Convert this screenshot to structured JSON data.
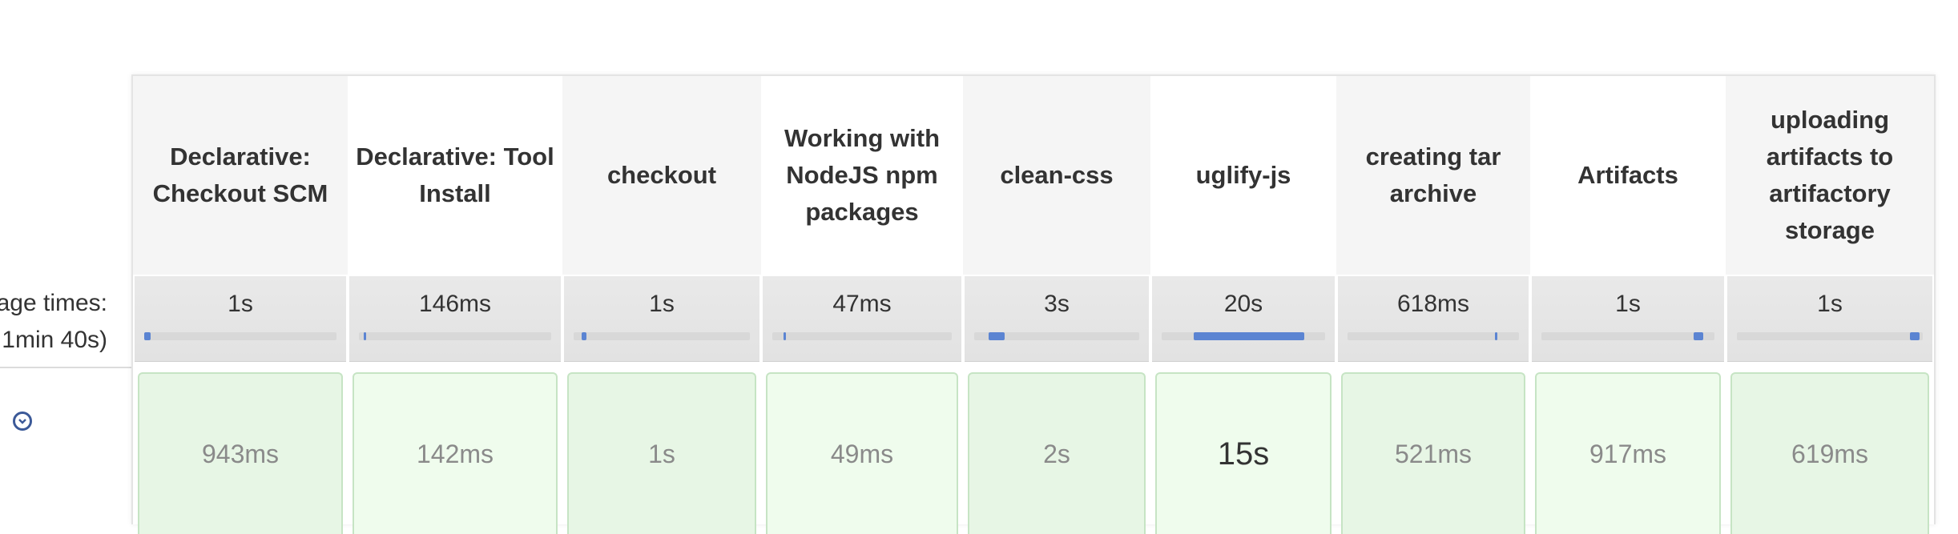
{
  "sidebar": {
    "avg_label_line1": "age times:",
    "avg_label_line2": "1min 40s)",
    "expand_icon": "expand-circle-icon"
  },
  "stages": [
    {
      "name": "Declarative: Checkout SCM",
      "avg": "1s",
      "progress": 0.0,
      "time": "943ms"
    },
    {
      "name": "Declarative: Tool Install",
      "avg": "146ms",
      "progress": 0.0,
      "time": "142ms"
    },
    {
      "name": "checkout",
      "avg": "1s",
      "progress": 0.0,
      "time": "1s"
    },
    {
      "name": "Working with NodeJS npm packages",
      "avg": "47ms",
      "progress": 0.0,
      "time": "49ms"
    },
    {
      "name": "clean-css",
      "avg": "3s",
      "progress": 0.03,
      "time": "2s"
    },
    {
      "name": "uglify-js",
      "avg": "20s",
      "progress": 0.2,
      "time": "15s"
    },
    {
      "name": "creating tar archive",
      "avg": "618ms",
      "progress": 0.01,
      "time": "521ms"
    },
    {
      "name": "Artifacts",
      "avg": "1s",
      "progress": 0.01,
      "time": "917ms"
    },
    {
      "name": "uploading artifacts to artifactory storage",
      "avg": "1s",
      "progress": 0.01,
      "time": "619ms"
    }
  ],
  "colors": {
    "progress_fill": "#5b84d2",
    "progress_track": "#d8d8d8",
    "success_cell": "#e7f6e5",
    "success_border": "#c6e4c4",
    "header_shade": "#f5f5f5"
  }
}
